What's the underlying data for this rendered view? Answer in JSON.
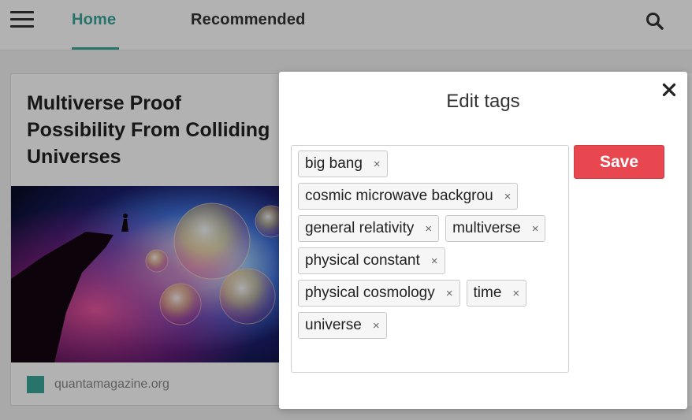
{
  "nav": {
    "tabs": [
      {
        "label": "Home",
        "active": true
      },
      {
        "label": "Recommended",
        "active": false
      }
    ],
    "menu_icon": "hamburger-menu-icon",
    "search_icon": "search-icon",
    "accent_color": "#3aa79a"
  },
  "card": {
    "title": "Multiverse Proof\nPossibility From Colliding\nUniverses",
    "source": "quantamagazine.org",
    "source_color": "#3aa79a"
  },
  "modal": {
    "title": "Edit tags",
    "close_icon": "close-icon",
    "save_label": "Save",
    "save_color": "#e8474f",
    "tags": [
      "big bang",
      "cosmic microwave backgrou",
      "general relativity",
      "multiverse",
      "physical constant",
      "physical cosmology",
      "time",
      "universe"
    ],
    "remove_glyph": "×"
  }
}
